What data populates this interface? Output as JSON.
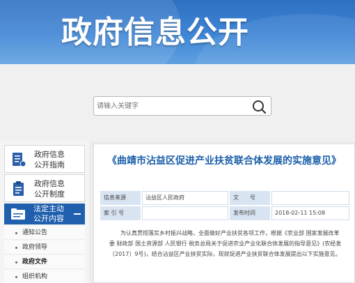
{
  "banner": {
    "title": "政府信息公开"
  },
  "search": {
    "placeholder": "请输入关键字"
  },
  "sidebar": {
    "items": [
      {
        "line1": "政府信息",
        "line2": "公开指南"
      },
      {
        "line1": "政府信息",
        "line2": "公开制度"
      }
    ],
    "active": {
      "line1": "法定主动",
      "line2": "公开内容"
    },
    "subitems": [
      "通知公告",
      "政府领导",
      "政府文件",
      "组织机构"
    ]
  },
  "article": {
    "title": "《曲靖市沾益区促进产业扶贫联合体发展的实施意见》",
    "meta": {
      "source_label": "信息来源",
      "source_value": "沾益区人民政府",
      "docno_label": "文　　号",
      "docno_value": "",
      "index_label": "索 引 号",
      "index_value": "",
      "date_label": "发布时间",
      "date_value": "2018-02-11 15:08"
    },
    "body": "为认真贯彻落实乡村振兴战略，全面做好产业扶贫各项工作，根据《农业部 国家发展改革委 财政部 国土资源部 人民银行 税务总局关于促进农业产业化联合体发展的指导意见》(农经发〔2017〕9号)，结合沾益区产业扶贫实际，现就促进产业扶贫联合体发展提出以下实施意见。"
  }
}
